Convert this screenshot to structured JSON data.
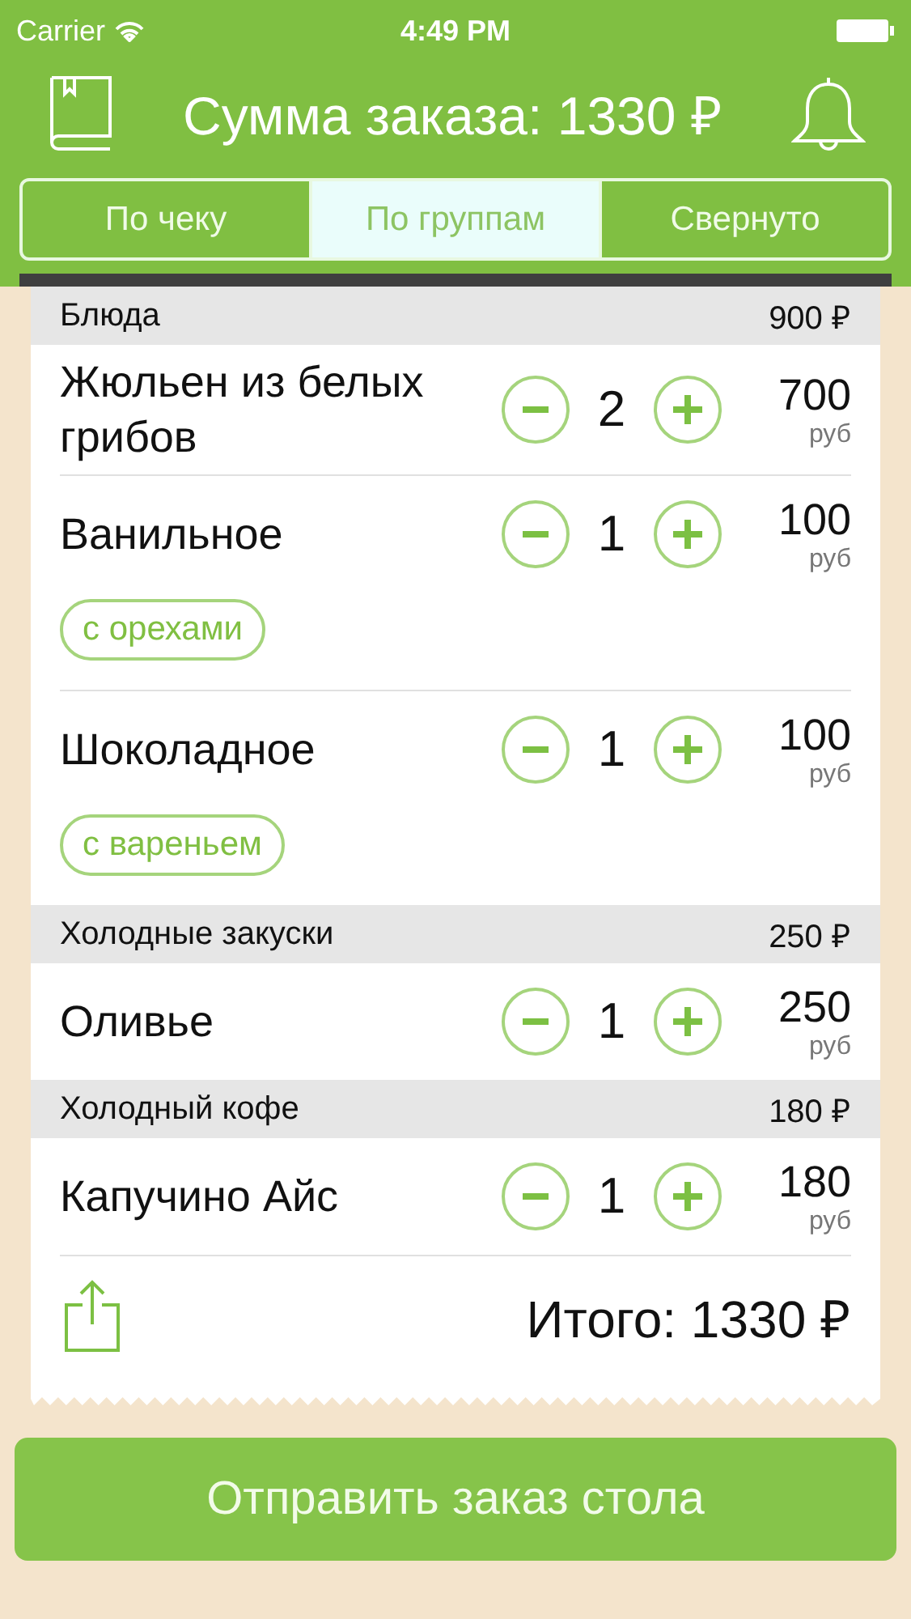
{
  "status_bar": {
    "carrier": "Carrier",
    "time": "4:49 PM"
  },
  "header": {
    "title": "Сумма заказа: 1330 ₽"
  },
  "tabs": [
    {
      "label": "По чеку",
      "selected": false
    },
    {
      "label": "По группам",
      "selected": true
    },
    {
      "label": "Свернуто",
      "selected": false
    }
  ],
  "groups": [
    {
      "name": "Блюда",
      "total": "900 ₽",
      "items": [
        {
          "name": "Жюльен из белых грибов",
          "quantity": "2",
          "price": "700",
          "unit": "руб"
        },
        {
          "name": "Ванильное",
          "quantity": "1",
          "price": "100",
          "unit": "руб",
          "modifier": "с орехами"
        },
        {
          "name": "Шоколадное",
          "quantity": "1",
          "price": "100",
          "unit": "руб",
          "modifier": "с вареньем"
        }
      ]
    },
    {
      "name": "Холодные закуски",
      "total": "250 ₽",
      "items": [
        {
          "name": "Оливье",
          "quantity": "1",
          "price": "250",
          "unit": "руб"
        }
      ]
    },
    {
      "name": "Холодный кофе",
      "total": "180 ₽",
      "items": [
        {
          "name": "Капучино Айс",
          "quantity": "1",
          "price": "180",
          "unit": "руб"
        }
      ]
    }
  ],
  "total": "Итого: 1330 ₽",
  "submit_button": "Отправить заказ стола"
}
